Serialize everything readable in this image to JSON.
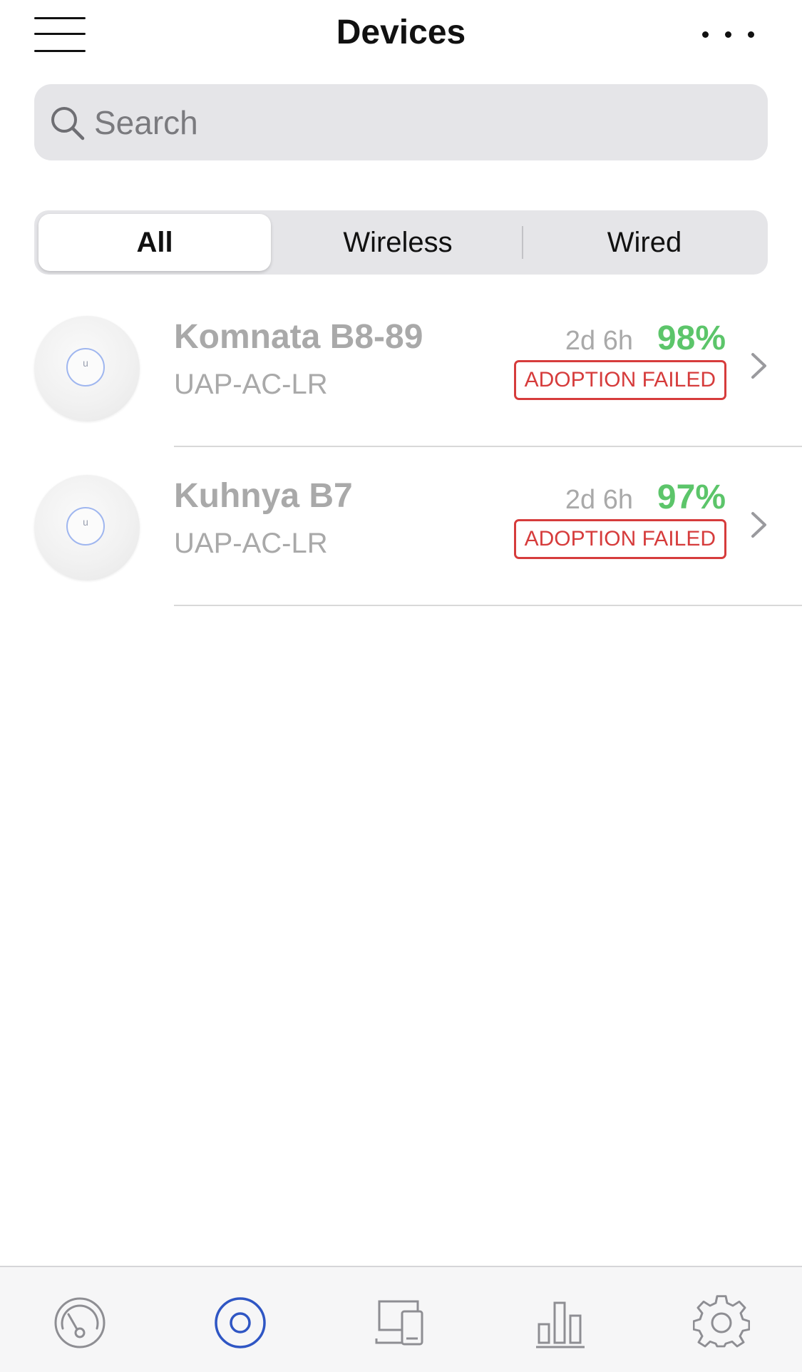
{
  "header": {
    "title": "Devices"
  },
  "search": {
    "placeholder": "Search",
    "value": ""
  },
  "filter_tabs": [
    {
      "label": "All",
      "selected": true
    },
    {
      "label": "Wireless",
      "selected": false
    },
    {
      "label": "Wired",
      "selected": false
    }
  ],
  "devices": [
    {
      "name": "Komnata B8-89",
      "model": "UAP-AC-LR",
      "uptime": "2d 6h",
      "signal": "98%",
      "status": "ADOPTION FAILED"
    },
    {
      "name": "Kuhnya B7",
      "model": "UAP-AC-LR",
      "uptime": "2d 6h",
      "signal": "97%",
      "status": "ADOPTION FAILED"
    }
  ],
  "bottom_nav": [
    {
      "icon": "dashboard-gauge-icon",
      "active": false
    },
    {
      "icon": "devices-icon",
      "active": true
    },
    {
      "icon": "clients-icon",
      "active": false
    },
    {
      "icon": "statistics-icon",
      "active": false
    },
    {
      "icon": "settings-icon",
      "active": false
    }
  ],
  "colors": {
    "accent": "#2f56c4",
    "signal_good": "#5cc56a",
    "status_error": "#d63c3c",
    "muted_text": "#a9a9a9"
  }
}
